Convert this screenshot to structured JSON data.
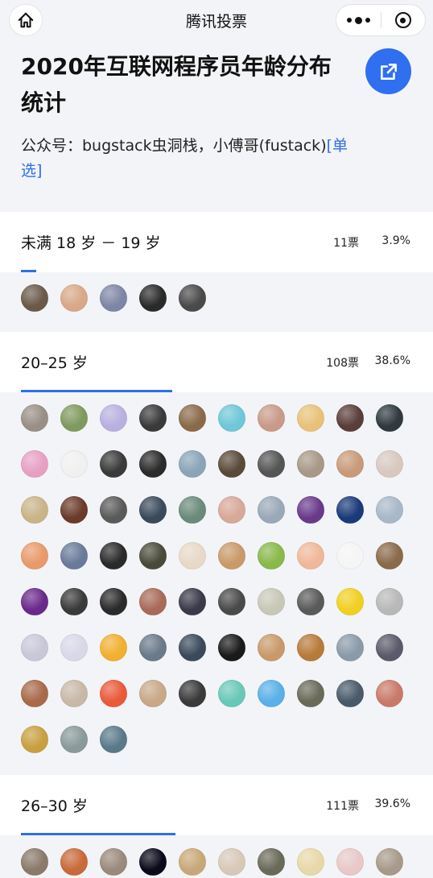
{
  "nav": {
    "title": "腾讯投票",
    "home_icon": "home-icon",
    "more_icon": "more-icon",
    "close_icon": "mini-program-close-icon"
  },
  "poll": {
    "title": "2020年互联网程序员年龄分布统计",
    "author": "公众号：bugstack虫洞栈，小傅哥(fustack)",
    "type_tag": "[单选]",
    "share_icon": "share-icon",
    "accent": "#2d6fe8"
  },
  "options": [
    {
      "label": "未满 18 岁 － 19 岁",
      "votes": "11票",
      "percent": "3.9%",
      "ratio": 0.039,
      "avatar_colors": [
        "#6b5a4a",
        "#d8a888",
        "#7e86a6",
        "#2a2a2a",
        "#4a4a4a"
      ]
    },
    {
      "label": "20–25 岁",
      "votes": "108票",
      "percent": "38.6%",
      "ratio": 0.386,
      "avatar_colors": [
        "#9a8f86",
        "#7f9a5e",
        "#b9b0e0",
        "#3a3a3a",
        "#8a6a4a",
        "#6fc7d8",
        "#c99a8a",
        "#e8c27a",
        "#5a3e3a",
        "#2f3a3f",
        "#e6a0c4",
        "#f0f0f0",
        "#3a3a3a",
        "#2b2b2b",
        "#8aa4b8",
        "#5a4a3a",
        "#555555",
        "#a89888",
        "#c89a7a",
        "#d8c8c0",
        "#c9b48a",
        "#6a3a2a",
        "#5a5a5a",
        "#3a4a5a",
        "#6a8a7a",
        "#d8a898",
        "#9aa8b8",
        "#6a3a8a",
        "#1a3a7a",
        "#a8b8c8",
        "#e89a6a",
        "#6a7a9a",
        "#2a2a2a",
        "#4a4a3a",
        "#e8d8c8",
        "#c89a6a",
        "#8ab84a",
        "#f0b89a",
        "#f5f5f5",
        "#8a6a4a",
        "#6a2a8a",
        "#3a3a3a",
        "#2a2a2a",
        "#a86a5a",
        "#3a3a4a",
        "#4a4a4a",
        "#c8c8b8",
        "#5a5a5a",
        "#f0d020",
        "#b8b8b8",
        "#c8c8d8",
        "#d8d8e8",
        "#f0b030",
        "#6a7a8a",
        "#3a4a5a",
        "#1a1a1a",
        "#c89a6a",
        "#b87a3a",
        "#8a9aa8",
        "#5a5a6a",
        "#a86a4a",
        "#c8b8a8",
        "#e85a3a",
        "#c8a888",
        "#3a3a3a",
        "#6ac8b8",
        "#5ab0e8",
        "#6a6a5a",
        "#4a5a6a",
        "#c87a6a",
        "#c8a040",
        "#8a9a9a",
        "#5a7a8a"
      ]
    },
    {
      "label": "26–30 岁",
      "votes": "111票",
      "percent": "39.6%",
      "ratio": 0.396,
      "avatar_colors": [
        "#8a7a6a",
        "#c86a3a",
        "#9a8a7a",
        "#0a0a1a",
        "#c8a878",
        "#d8c8b8",
        "#6a6a5a",
        "#e8d8a8",
        "#e8c8c8",
        "#a89a8a"
      ]
    }
  ]
}
